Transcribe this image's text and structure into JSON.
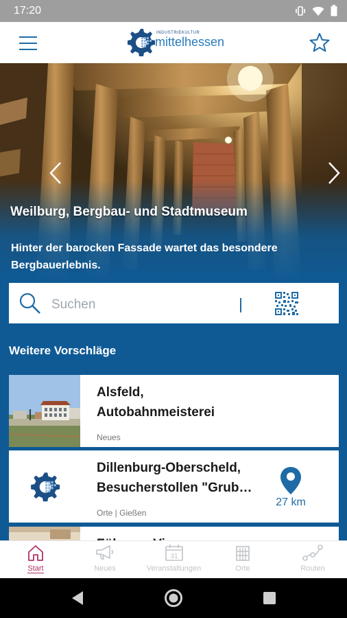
{
  "status_bar": {
    "time": "17:20",
    "icons": [
      "vibrate-icon",
      "wifi-icon",
      "battery-icon"
    ]
  },
  "app_bar": {
    "menu_icon": "hamburger-icon",
    "logo_small": "INDUSTRIEKULTUR",
    "logo_main": "mittelhessen",
    "favorite_icon": "star-outline-icon"
  },
  "hero": {
    "title": "Weilburg, Bergbau- und Stadtmuseum",
    "subtitle": "Hinter der barocken Fassade wartet das besondere Bergbauerlebnis.",
    "prev_icon": "chevron-left-icon",
    "next_icon": "chevron-right-icon"
  },
  "search": {
    "placeholder": "Suchen",
    "search_icon": "magnifier-icon",
    "qr_icon": "qr-code-icon"
  },
  "suggestions": {
    "heading": "Weitere Vorschläge",
    "cards": [
      {
        "title_line1": "Alsfeld,",
        "title_line2": "Autobahnmeisterei",
        "meta": "Neues",
        "thumb": "photo-alsfeld"
      },
      {
        "title_line1": "Dillenburg-Oberscheld,",
        "title_line2": "Besucherstollen \"Grub…",
        "meta": "Orte | Gießen",
        "thumb": "logo-thumbnail",
        "distance": "27 km",
        "distance_icon": "map-pin-icon"
      },
      {
        "title_line1": "Führung Viseum",
        "thumb": "photo-viseum"
      }
    ]
  },
  "bottom_nav": {
    "items": [
      {
        "label": "Start",
        "icon": "home-icon",
        "active": true
      },
      {
        "label": "Neues",
        "icon": "megaphone-icon",
        "active": false
      },
      {
        "label": "Veranstaltungen",
        "icon": "calendar-icon",
        "active": false
      },
      {
        "label": "Orte",
        "icon": "building-icon",
        "active": false
      },
      {
        "label": "Routen",
        "icon": "route-icon",
        "active": false
      }
    ],
    "calendar_day": "31"
  },
  "system_nav": {
    "back_icon": "back-triangle-icon",
    "home_icon": "home-circle-icon",
    "recents_icon": "recents-square-icon"
  },
  "colors": {
    "primary_blue": "#0f5a95",
    "accent_blue": "#1e6ba6",
    "active_nav": "#b03068"
  }
}
